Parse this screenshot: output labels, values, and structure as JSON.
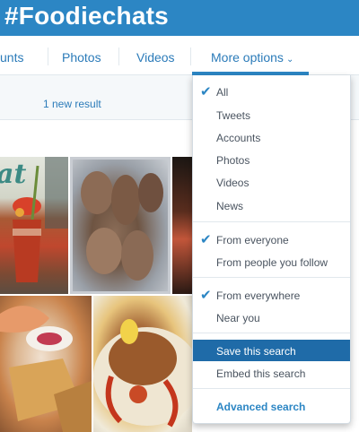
{
  "header": {
    "title": "#Foodiechats",
    "bg_color": "#2c86c4"
  },
  "tabs": [
    {
      "label": "unts",
      "name": "tab-accounts"
    },
    {
      "label": "Photos",
      "name": "tab-photos"
    },
    {
      "label": "Videos",
      "name": "tab-videos"
    },
    {
      "label": "More options",
      "name": "tab-more-options",
      "icon": "chevron-down-icon",
      "active": true
    }
  ],
  "new_result": {
    "text": "1 new result"
  },
  "photos": [
    {
      "name": "photo-bloody-mary",
      "logo_text": "at"
    },
    {
      "name": "photo-lobster-tails"
    },
    {
      "name": "photo-dark-dish"
    },
    {
      "name": "photo-shrimp-nachos"
    },
    {
      "name": "photo-crawfish-plate"
    }
  ],
  "menu": {
    "sections": [
      {
        "items": [
          {
            "label": "All",
            "checked": true
          },
          {
            "label": "Tweets"
          },
          {
            "label": "Accounts"
          },
          {
            "label": "Photos"
          },
          {
            "label": "Videos"
          },
          {
            "label": "News"
          }
        ]
      },
      {
        "items": [
          {
            "label": "From everyone",
            "checked": true
          },
          {
            "label": "From people you follow"
          }
        ]
      },
      {
        "items": [
          {
            "label": "From everywhere",
            "checked": true
          },
          {
            "label": "Near you"
          }
        ]
      },
      {
        "items": [
          {
            "label": "Save this search",
            "highlighted": true
          },
          {
            "label": "Embed this search"
          }
        ]
      },
      {
        "items": [
          {
            "label": "Advanced search",
            "accent": true
          }
        ]
      }
    ],
    "check_glyph": "✔",
    "accent_color": "#2c86c4",
    "highlight_color": "#1f6ba8"
  }
}
